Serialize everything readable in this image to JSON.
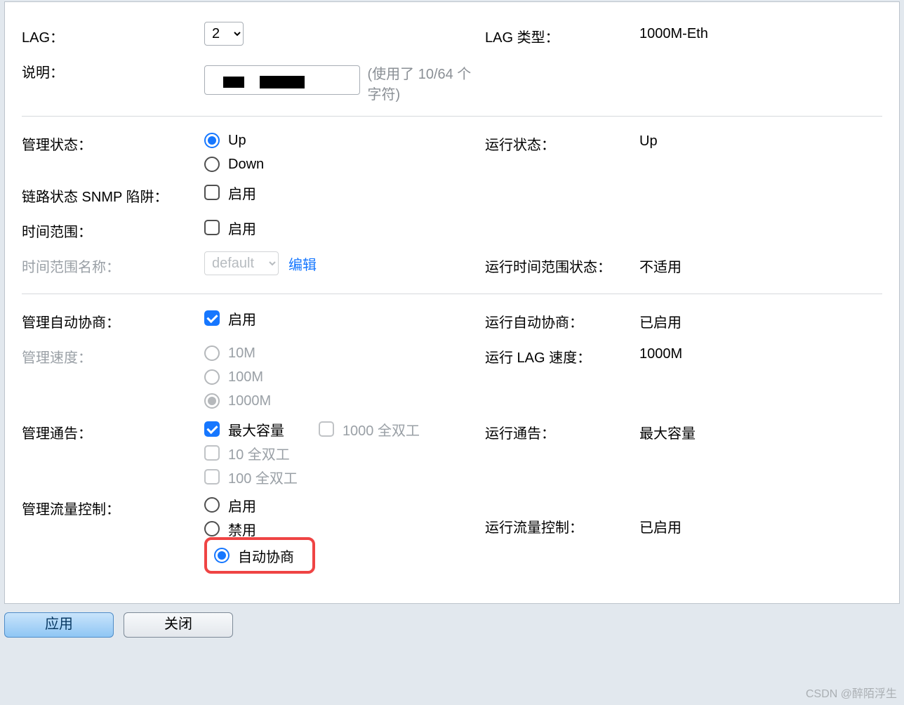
{
  "section1": {
    "lag_label": "LAG：",
    "lag_value": "2",
    "lag_type_label": "LAG 类型：",
    "lag_type_value": "1000M-Eth",
    "desc_label": "说明：",
    "desc_value": "",
    "desc_hint": "(使用了 10/64 个字符)"
  },
  "section2": {
    "admin_state_label": "管理状态：",
    "admin_state_up": "Up",
    "admin_state_down": "Down",
    "oper_state_label": "运行状态：",
    "oper_state_value": "Up",
    "snmp_trap_label": "链路状态 SNMP 陷阱：",
    "snmp_trap_opt": "启用",
    "time_range_label": "时间范围：",
    "time_range_opt": "启用",
    "time_range_name_label": "时间范围名称：",
    "time_range_name_value": "default",
    "time_range_edit": "编辑",
    "oper_time_range_label": "运行时间范围状态：",
    "oper_time_range_value": "不适用"
  },
  "section3": {
    "auto_neg_label": "管理自动协商：",
    "auto_neg_opt": "启用",
    "oper_auto_neg_label": "运行自动协商：",
    "oper_auto_neg_value": "已启用",
    "admin_speed_label": "管理速度：",
    "speed_10": "10M",
    "speed_100": "100M",
    "speed_1000": "1000M",
    "oper_speed_label": "运行 LAG 速度：",
    "oper_speed_value": "1000M",
    "admin_adv_label": "管理通告：",
    "adv_max": "最大容量",
    "adv_10fd": "10 全双工",
    "adv_100fd": "100 全双工",
    "adv_1000fd": "1000 全双工",
    "oper_adv_label": "运行通告：",
    "oper_adv_value": "最大容量",
    "flow_ctrl_label": "管理流量控制：",
    "flow_enable": "启用",
    "flow_disable": "禁用",
    "flow_auto": "自动协商",
    "oper_flow_label": "运行流量控制：",
    "oper_flow_value": "已启用"
  },
  "buttons": {
    "apply": "应用",
    "close": "关闭"
  },
  "watermark": "CSDN @醉陌浮生"
}
